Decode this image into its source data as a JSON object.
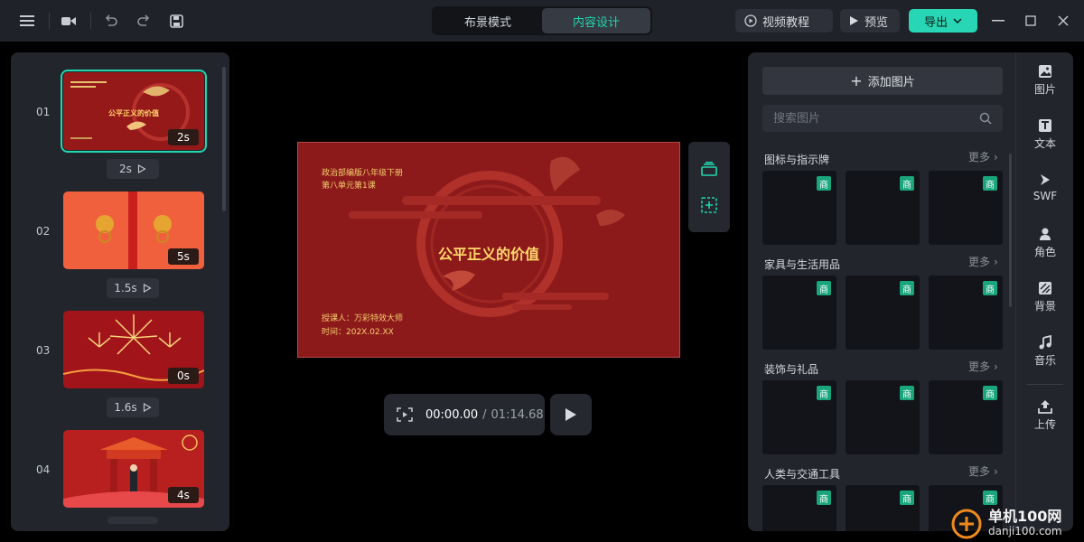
{
  "topbar": {
    "modes": [
      "布景模式",
      "内容设计"
    ],
    "active_mode": "内容设计",
    "video_tutorial": "视频教程",
    "preview": "预览",
    "export": "导出"
  },
  "slides": [
    {
      "num": "01",
      "duration": "2s",
      "transition": "2s"
    },
    {
      "num": "02",
      "duration": "5s",
      "transition": "1.5s"
    },
    {
      "num": "03",
      "duration": "0s",
      "transition": "1.6s"
    },
    {
      "num": "04",
      "duration": "4s"
    }
  ],
  "slide1_thumb_title": "公平正义的价值",
  "canvas": {
    "line1": "政治部编版八年级下册",
    "line2": "第八单元第1课",
    "title": "公平正义的价值",
    "speaker": "授课人：万彩特效大师",
    "time": "时间：202X.02.XX"
  },
  "player": {
    "current": "00:00.00",
    "separator": "/",
    "total": "01:14.68"
  },
  "right": {
    "add_image": "添加图片",
    "search_placeholder": "搜索图片",
    "more": "更多",
    "badge": "商",
    "categories": [
      "图标与指示牌",
      "家具与生活用品",
      "装饰与礼品",
      "人类与交通工具"
    ]
  },
  "rail": [
    "图片",
    "文本",
    "SWF",
    "角色",
    "背景",
    "音乐",
    "上传"
  ],
  "watermark": {
    "name": "单机100网",
    "url": "danji100.com"
  },
  "colors": {
    "accent": "#22d6b0",
    "export": "#28d6b5",
    "canvas_red": "#8d1a1b",
    "badge_green": "#1aa67c"
  }
}
